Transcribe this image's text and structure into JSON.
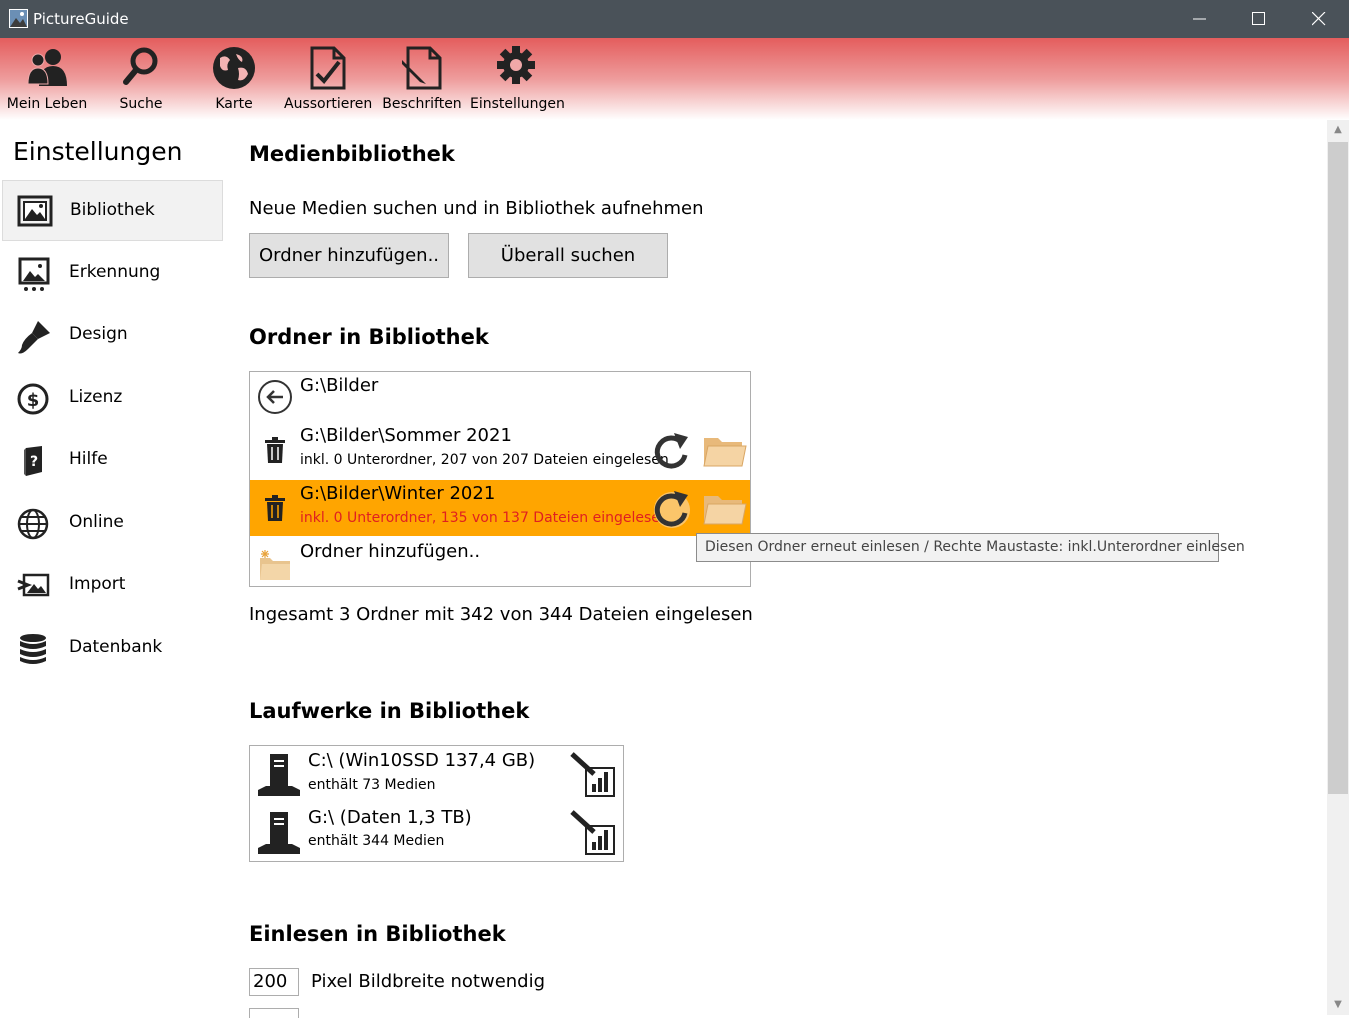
{
  "window": {
    "title": "PictureGuide"
  },
  "toolbar": {
    "items": [
      {
        "label": "Mein Leben",
        "icon": "people-icon"
      },
      {
        "label": "Suche",
        "icon": "search-icon"
      },
      {
        "label": "Karte",
        "icon": "globe-icon"
      },
      {
        "label": "Aussortieren",
        "icon": "document-check-icon"
      },
      {
        "label": "Beschriften",
        "icon": "document-edit-icon"
      },
      {
        "label": "Einstellungen",
        "icon": "gear-icon"
      }
    ]
  },
  "sidebar": {
    "title": "Einstellungen",
    "items": [
      {
        "label": "Bibliothek",
        "icon": "picture-frame-icon",
        "active": true
      },
      {
        "label": "Erkennung",
        "icon": "picture-scan-icon"
      },
      {
        "label": "Design",
        "icon": "brush-icon"
      },
      {
        "label": "Lizenz",
        "icon": "dollar-coin-icon"
      },
      {
        "label": "Hilfe",
        "icon": "help-book-icon"
      },
      {
        "label": "Online",
        "icon": "globe-grid-icon"
      },
      {
        "label": "Import",
        "icon": "image-import-icon"
      },
      {
        "label": "Datenbank",
        "icon": "database-icon"
      }
    ]
  },
  "content": {
    "section_media": "Medienbibliothek",
    "media_desc": "Neue Medien suchen und in Bibliothek aufnehmen",
    "btn_add_folder": "Ordner hinzufügen..",
    "btn_search_all": "Überall suchen",
    "section_folders": "Ordner in Bibliothek",
    "folders": {
      "parent": "G:\\Bilder",
      "rows": [
        {
          "path": "G:\\Bilder\\Sommer 2021",
          "info": "inkl. 0 Unterordner, 207 von 207 Dateien eingelesen",
          "highlighted": false
        },
        {
          "path": "G:\\Bilder\\Winter 2021",
          "info": "inkl. 0 Unterordner, 135 von 137 Dateien eingelesen",
          "highlighted": true
        }
      ],
      "add_label": "Ordner hinzufügen.."
    },
    "tooltip": "Diesen Ordner erneut einlesen / Rechte Maustaste: inkl.Unterordner einlesen",
    "total": "Ingesamt  3 Ordner mit 342 von 344 Dateien eingelesen",
    "section_drives": "Laufwerke in Bibliothek",
    "drives": [
      {
        "title": "C:\\ (Win10SSD 137,4 GB)",
        "info": "enthält 73 Medien"
      },
      {
        "title": "G:\\ (Daten 1,3 TB)",
        "info": "enthält 344 Medien"
      }
    ],
    "section_read": "Einlesen in Bibliothek",
    "min_width_value": "200",
    "min_width_label": "Pixel Bildbreite notwendig"
  },
  "colors": {
    "accent": "#ffa500",
    "toolbar_red": "#e45d5d",
    "titlebar": "#4a5259",
    "warning_text": "#e02020"
  }
}
